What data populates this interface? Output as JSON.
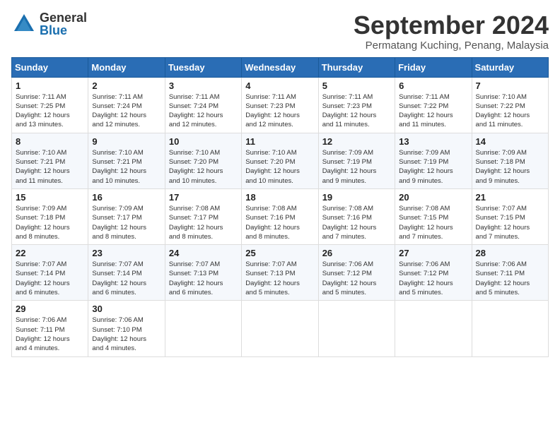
{
  "header": {
    "logo_general": "General",
    "logo_blue": "Blue",
    "month_year": "September 2024",
    "location": "Permatang Kuching, Penang, Malaysia"
  },
  "weekdays": [
    "Sunday",
    "Monday",
    "Tuesday",
    "Wednesday",
    "Thursday",
    "Friday",
    "Saturday"
  ],
  "weeks": [
    [
      {
        "day": "1",
        "sunrise": "7:11 AM",
        "sunset": "7:25 PM",
        "daylight": "12 hours and 13 minutes."
      },
      {
        "day": "2",
        "sunrise": "7:11 AM",
        "sunset": "7:24 PM",
        "daylight": "12 hours and 12 minutes."
      },
      {
        "day": "3",
        "sunrise": "7:11 AM",
        "sunset": "7:24 PM",
        "daylight": "12 hours and 12 minutes."
      },
      {
        "day": "4",
        "sunrise": "7:11 AM",
        "sunset": "7:23 PM",
        "daylight": "12 hours and 12 minutes."
      },
      {
        "day": "5",
        "sunrise": "7:11 AM",
        "sunset": "7:23 PM",
        "daylight": "12 hours and 11 minutes."
      },
      {
        "day": "6",
        "sunrise": "7:11 AM",
        "sunset": "7:22 PM",
        "daylight": "12 hours and 11 minutes."
      },
      {
        "day": "7",
        "sunrise": "7:10 AM",
        "sunset": "7:22 PM",
        "daylight": "12 hours and 11 minutes."
      }
    ],
    [
      {
        "day": "8",
        "sunrise": "7:10 AM",
        "sunset": "7:21 PM",
        "daylight": "12 hours and 11 minutes."
      },
      {
        "day": "9",
        "sunrise": "7:10 AM",
        "sunset": "7:21 PM",
        "daylight": "12 hours and 10 minutes."
      },
      {
        "day": "10",
        "sunrise": "7:10 AM",
        "sunset": "7:20 PM",
        "daylight": "12 hours and 10 minutes."
      },
      {
        "day": "11",
        "sunrise": "7:10 AM",
        "sunset": "7:20 PM",
        "daylight": "12 hours and 10 minutes."
      },
      {
        "day": "12",
        "sunrise": "7:09 AM",
        "sunset": "7:19 PM",
        "daylight": "12 hours and 9 minutes."
      },
      {
        "day": "13",
        "sunrise": "7:09 AM",
        "sunset": "7:19 PM",
        "daylight": "12 hours and 9 minutes."
      },
      {
        "day": "14",
        "sunrise": "7:09 AM",
        "sunset": "7:18 PM",
        "daylight": "12 hours and 9 minutes."
      }
    ],
    [
      {
        "day": "15",
        "sunrise": "7:09 AM",
        "sunset": "7:18 PM",
        "daylight": "12 hours and 8 minutes."
      },
      {
        "day": "16",
        "sunrise": "7:09 AM",
        "sunset": "7:17 PM",
        "daylight": "12 hours and 8 minutes."
      },
      {
        "day": "17",
        "sunrise": "7:08 AM",
        "sunset": "7:17 PM",
        "daylight": "12 hours and 8 minutes."
      },
      {
        "day": "18",
        "sunrise": "7:08 AM",
        "sunset": "7:16 PM",
        "daylight": "12 hours and 8 minutes."
      },
      {
        "day": "19",
        "sunrise": "7:08 AM",
        "sunset": "7:16 PM",
        "daylight": "12 hours and 7 minutes."
      },
      {
        "day": "20",
        "sunrise": "7:08 AM",
        "sunset": "7:15 PM",
        "daylight": "12 hours and 7 minutes."
      },
      {
        "day": "21",
        "sunrise": "7:07 AM",
        "sunset": "7:15 PM",
        "daylight": "12 hours and 7 minutes."
      }
    ],
    [
      {
        "day": "22",
        "sunrise": "7:07 AM",
        "sunset": "7:14 PM",
        "daylight": "12 hours and 6 minutes."
      },
      {
        "day": "23",
        "sunrise": "7:07 AM",
        "sunset": "7:14 PM",
        "daylight": "12 hours and 6 minutes."
      },
      {
        "day": "24",
        "sunrise": "7:07 AM",
        "sunset": "7:13 PM",
        "daylight": "12 hours and 6 minutes."
      },
      {
        "day": "25",
        "sunrise": "7:07 AM",
        "sunset": "7:13 PM",
        "daylight": "12 hours and 5 minutes."
      },
      {
        "day": "26",
        "sunrise": "7:06 AM",
        "sunset": "7:12 PM",
        "daylight": "12 hours and 5 minutes."
      },
      {
        "day": "27",
        "sunrise": "7:06 AM",
        "sunset": "7:12 PM",
        "daylight": "12 hours and 5 minutes."
      },
      {
        "day": "28",
        "sunrise": "7:06 AM",
        "sunset": "7:11 PM",
        "daylight": "12 hours and 5 minutes."
      }
    ],
    [
      {
        "day": "29",
        "sunrise": "7:06 AM",
        "sunset": "7:11 PM",
        "daylight": "12 hours and 4 minutes."
      },
      {
        "day": "30",
        "sunrise": "7:06 AM",
        "sunset": "7:10 PM",
        "daylight": "12 hours and 4 minutes."
      },
      null,
      null,
      null,
      null,
      null
    ]
  ],
  "labels": {
    "sunrise": "Sunrise:",
    "sunset": "Sunset:",
    "daylight": "Daylight:"
  }
}
